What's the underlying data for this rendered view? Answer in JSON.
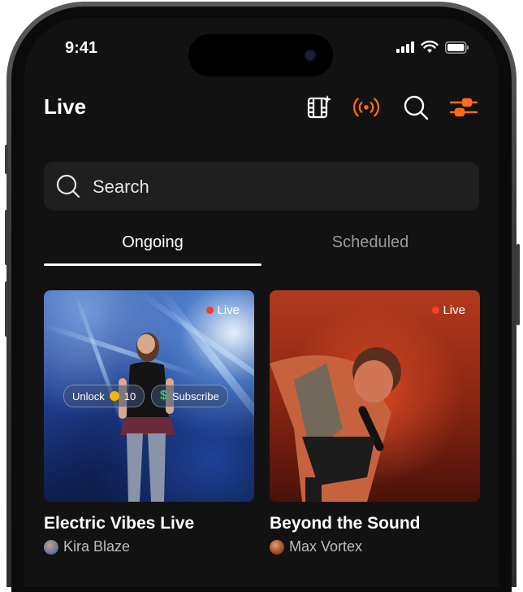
{
  "status": {
    "time": "9:41"
  },
  "header": {
    "title": "Live",
    "icons": [
      "film-sparkle-icon",
      "broadcast-icon",
      "search-icon",
      "filter-sliders-icon"
    ]
  },
  "colors": {
    "accent": "#ff6a1a",
    "background": "#121212",
    "live": "#ff3b30"
  },
  "search": {
    "placeholder": "Search"
  },
  "tabs": [
    {
      "label": "Ongoing",
      "active": true
    },
    {
      "label": "Scheduled",
      "active": false
    }
  ],
  "streams": [
    {
      "badge": "Live",
      "unlock_label": "Unlock",
      "unlock_cost": "10",
      "subscribe_label": "Subscribe",
      "title": "Electric Vibes Live",
      "author": "Kira Blaze"
    },
    {
      "badge": "Live",
      "title": "Beyond the Sound",
      "author": "Max Vortex"
    }
  ]
}
